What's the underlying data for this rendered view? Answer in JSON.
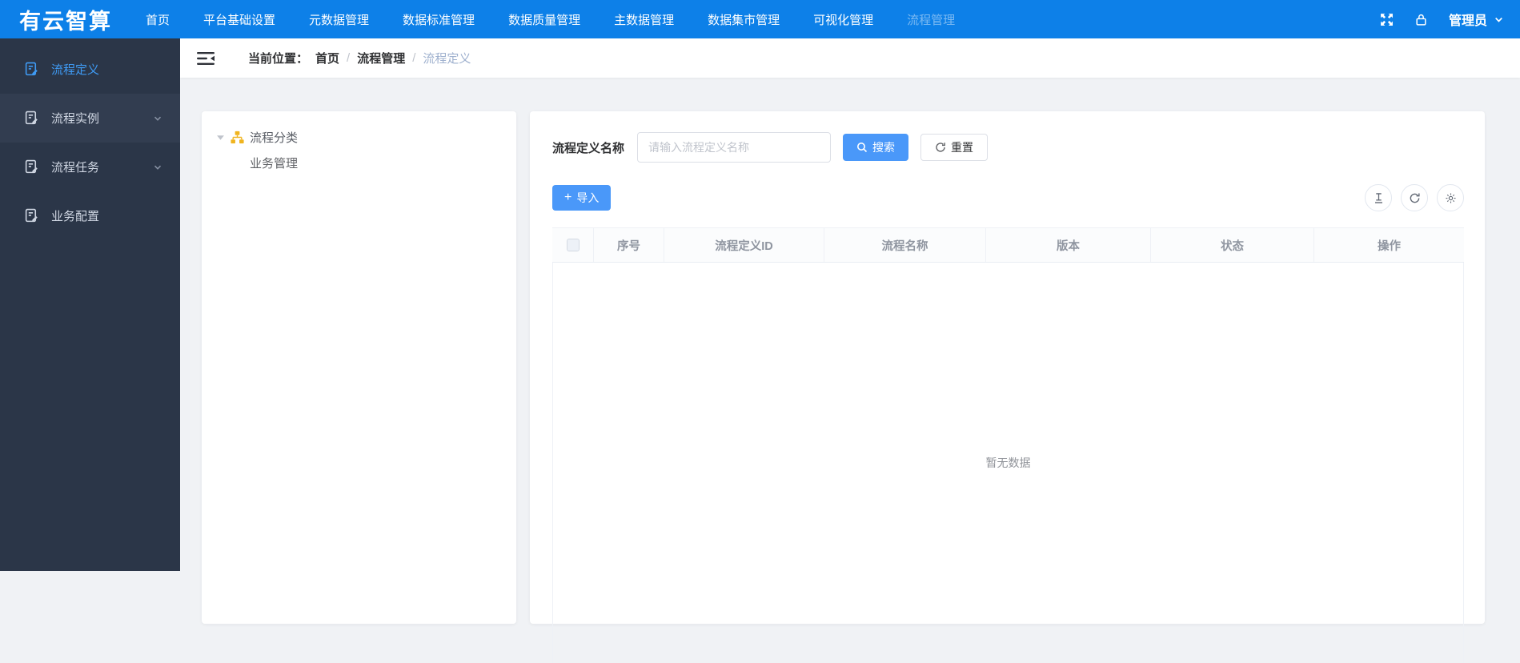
{
  "topbar": {
    "logo": "有云智算",
    "nav": [
      {
        "label": "首页"
      },
      {
        "label": "平台基础设置"
      },
      {
        "label": "元数据管理"
      },
      {
        "label": "数据标准管理"
      },
      {
        "label": "数据质量管理"
      },
      {
        "label": "主数据管理"
      },
      {
        "label": "数据集市管理"
      },
      {
        "label": "可视化管理"
      },
      {
        "label": "流程管理"
      }
    ],
    "user": "管理员"
  },
  "sidebar": {
    "items": [
      {
        "label": "流程定义"
      },
      {
        "label": "流程实例"
      },
      {
        "label": "流程任务"
      },
      {
        "label": "业务配置"
      }
    ]
  },
  "breadcrumb": {
    "prefix": "当前位置：",
    "separator": "/",
    "items": [
      "首页",
      "流程管理",
      "流程定义"
    ]
  },
  "tree": {
    "root": "流程分类",
    "children": [
      "业务管理"
    ]
  },
  "search": {
    "label": "流程定义名称",
    "placeholder": "请输入流程定义名称",
    "value": "",
    "search_label": "搜索",
    "reset_label": "重置"
  },
  "toolbar": {
    "import_label": "导入"
  },
  "icons": {
    "plus": "+"
  },
  "table": {
    "columns": [
      "序号",
      "流程定义ID",
      "流程名称",
      "版本",
      "状态",
      "操作"
    ],
    "rows": [],
    "empty_text": "暂无数据"
  },
  "colors": {
    "header_blue": "#0d80e8",
    "primary_button": "#4a98f9",
    "sidebar_bg": "#2b3648",
    "sidebar_active": "#3f9bf5",
    "tree_icon_gold": "#f0b41f"
  }
}
